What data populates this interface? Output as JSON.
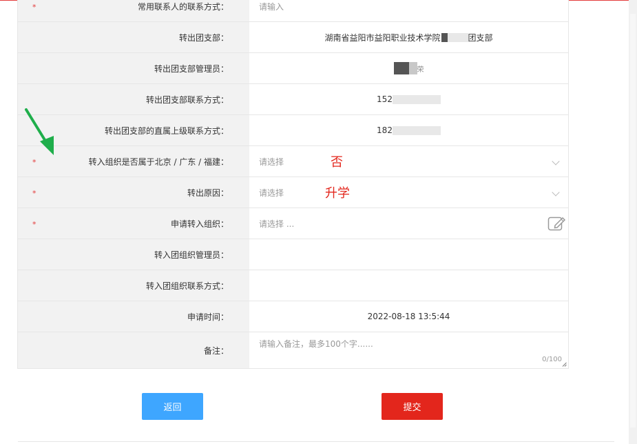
{
  "rows": [
    {
      "label": "常用联系人的联系方式：",
      "required": true,
      "kind": "placeholder",
      "value": "请输入"
    },
    {
      "label": "转出团支部：",
      "required": false,
      "kind": "center",
      "value_pre": "湖南省益阳市益阳职业技术学院",
      "value_post": "团支部"
    },
    {
      "label": "转出团支部管理员：",
      "required": false,
      "kind": "center",
      "value_pre": "",
      "value_post": "荣"
    },
    {
      "label": "转出团支部联系方式：",
      "required": false,
      "kind": "center",
      "value_pre": "152",
      "value_post": ""
    },
    {
      "label": "转出团支部的直属上级联系方式：",
      "required": false,
      "kind": "center",
      "value_pre": "182",
      "value_post": ""
    },
    {
      "label": "转入组织是否属于北京 / 广东 / 福建：",
      "required": true,
      "kind": "select",
      "placeholder": "请选择",
      "annotation": "否"
    },
    {
      "label": "转出原因：",
      "required": true,
      "kind": "select",
      "placeholder": "请选择",
      "annotation": "升学"
    },
    {
      "label": "申请转入组织：",
      "required": true,
      "kind": "picker",
      "placeholder": "请选择 ..."
    },
    {
      "label": "转入团组织管理员：",
      "required": false,
      "kind": "empty"
    },
    {
      "label": "转入团组织联系方式：",
      "required": false,
      "kind": "empty"
    },
    {
      "label": "申请时间：",
      "required": false,
      "kind": "center",
      "value_pre": "2022-08-18 13:5:44",
      "value_post": ""
    },
    {
      "label": "备注：",
      "required": false,
      "kind": "textarea",
      "placeholder": "请输入备注，最多100个字......",
      "counter": "0/100"
    }
  ],
  "required_mark": "*",
  "buttons": {
    "back": "返回",
    "submit": "提交"
  },
  "colors": {
    "accent_red": "#e3261c",
    "accent_blue": "#3ea6ff",
    "annotation_arrow": "#1fae4b"
  }
}
